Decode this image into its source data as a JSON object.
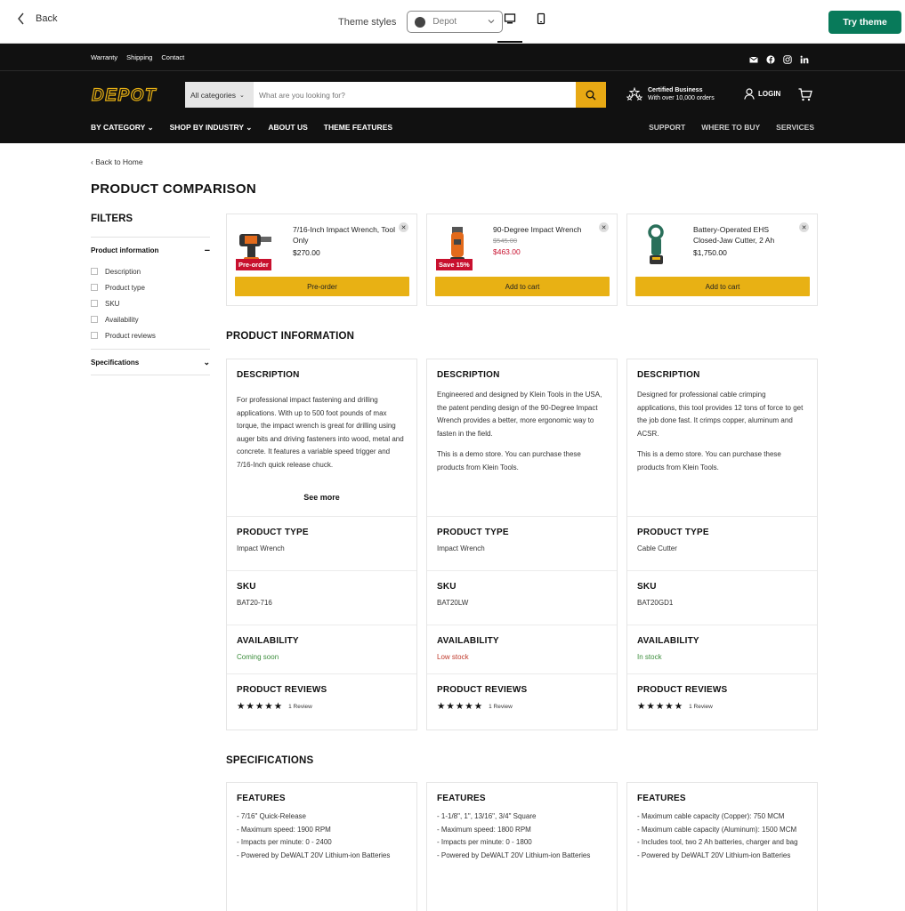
{
  "preview": {
    "back_label": "Back",
    "theme_styles_label": "Theme styles",
    "theme_selected": "Depot",
    "try_theme_label": "Try theme"
  },
  "utility": {
    "links": [
      "Warranty",
      "Shipping",
      "Contact"
    ]
  },
  "header": {
    "logo_text": "DEPOT",
    "search_category": "All categories",
    "search_placeholder": "What are you looking for?",
    "cert_title": "Certified Business",
    "cert_sub": "With over 10,000 orders",
    "login_label": "LOGIN",
    "nav_left": [
      "BY CATEGORY",
      "SHOP BY INDUSTRY",
      "ABOUT US",
      "THEME FEATURES"
    ],
    "nav_right": [
      "SUPPORT",
      "WHERE TO BUY",
      "SERVICES"
    ]
  },
  "page": {
    "breadcrumb": "Back to Home",
    "title": "PRODUCT COMPARISON",
    "filters_title": "FILTERS",
    "filter_groups": [
      {
        "label": "Product information",
        "items": [
          "Description",
          "Product type",
          "SKU",
          "Availability",
          "Product reviews"
        ]
      },
      {
        "label": "Specifications",
        "items": []
      }
    ]
  },
  "products": [
    {
      "name": "7/16-Inch Impact Wrench, Tool Only",
      "price": "$270.00",
      "compare": "",
      "badge": "Pre-order",
      "button": "Pre-order"
    },
    {
      "name": "90-Degree Impact Wrench",
      "price": "$463.00",
      "compare": "$545.00",
      "badge": "Save 15%",
      "button": "Add to cart"
    },
    {
      "name": "Battery-Operated EHS Closed-Jaw Cutter, 2 Ah",
      "price": "$1,750.00",
      "compare": "",
      "badge": "",
      "button": "Add to cart"
    }
  ],
  "product_info": {
    "title": "PRODUCT INFORMATION",
    "labels": {
      "description": "DESCRIPTION",
      "type": "PRODUCT TYPE",
      "sku": "SKU",
      "availability": "AVAILABILITY",
      "reviews": "PRODUCT REVIEWS"
    },
    "see_more": "See more",
    "columns": [
      {
        "desc": [
          "For professional impact fastening and drilling applications. With up to 500 foot pounds of max torque, the impact wrench is great for drilling using auger bits and driving fasteners into wood, metal and concrete. It features a variable speed trigger and 7/16-Inch quick release chuck."
        ],
        "type": "Impact Wrench",
        "sku": "BAT20-716",
        "availability": "Coming soon",
        "review_count": "1 Review"
      },
      {
        "desc": [
          "Engineered and designed by Klein Tools in the USA, the patent pending design of the 90-Degree Impact Wrench provides a better, more ergonomic way to fasten in the field.",
          "This is a demo store. You can purchase these products from Klein Tools."
        ],
        "type": "Impact Wrench",
        "sku": "BAT20LW",
        "availability": "Low stock",
        "review_count": "1 Review"
      },
      {
        "desc": [
          "Designed for professional cable crimping applications, this tool provides 12 tons of force to get the job done fast. It crimps copper, aluminum and ACSR.",
          "This is a demo store. You can purchase these products from Klein Tools."
        ],
        "type": "Cable Cutter",
        "sku": "BAT20GD1",
        "availability": "In stock",
        "review_count": "1 Review"
      }
    ],
    "rating": 5
  },
  "specifications": {
    "title": "SPECIFICATIONS",
    "features_label": "FEATURES",
    "columns": [
      [
        "- 7/16\" Quick-Release",
        "- Maximum speed: 1900 RPM",
        "- Impacts per minute: 0 - 2400",
        "- Powered by DeWALT 20V Lithium-ion Batteries"
      ],
      [
        "- 1-1/8\", 1\", 13/16\", 3/4\" Square",
        "- Maximum speed: 1800 RPM",
        "- Impacts per minute: 0 - 1800",
        "- Powered by DeWALT 20V Lithium-ion Batteries"
      ],
      [
        "- Maximum cable capacity (Copper): 750 MCM",
        "- Maximum cable capacity (Aluminum): 1500 MCM",
        "- Includes tool, two 2 Ah batteries, charger and bag",
        "- Powered by DeWALT 20V Lithium-ion Batteries"
      ]
    ]
  },
  "colors": {
    "accent": "#e8b114",
    "brand_green": "#087a5a",
    "header_bg": "#111111",
    "sale_red": "#c8102e"
  }
}
